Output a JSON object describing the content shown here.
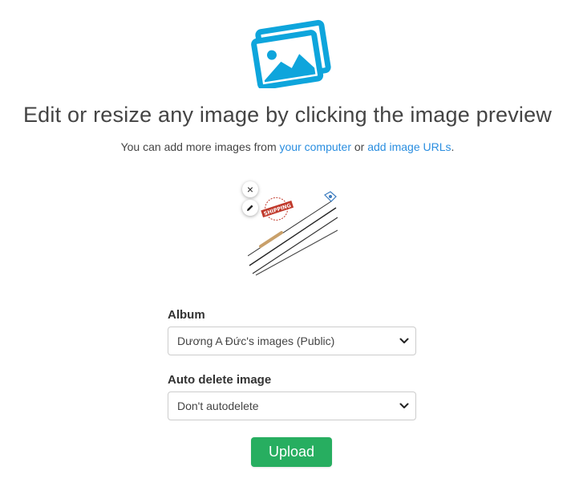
{
  "header": {
    "logo_icon": "images-icon",
    "accent_color": "#0ea5dc",
    "title": "Edit or resize any image by clicking the image preview",
    "subtitle_prefix": "You can add more images from ",
    "link_computer": "your computer",
    "subtitle_middle": " or ",
    "link_urls": "add image URLs",
    "subtitle_suffix": "."
  },
  "preview": {
    "remove_icon": "×",
    "edit_icon": "pencil-icon",
    "badge_text": "SHIPPING"
  },
  "form": {
    "album_label": "Album",
    "album_value": "Dương A Đức's images (Public)",
    "autodelete_label": "Auto delete image",
    "autodelete_value": "Don't autodelete"
  },
  "actions": {
    "upload_label": "Upload",
    "upload_color": "#27ae60"
  }
}
